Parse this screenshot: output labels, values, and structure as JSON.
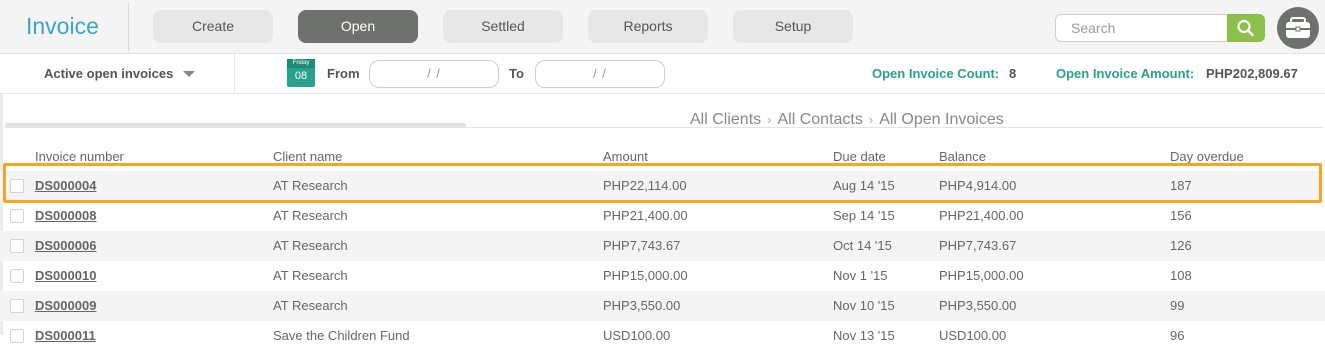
{
  "app": {
    "title": "Invoice"
  },
  "nav": {
    "items": [
      {
        "label": "Create"
      },
      {
        "label": "Open"
      },
      {
        "label": "Settled"
      },
      {
        "label": "Reports"
      },
      {
        "label": "Setup"
      }
    ],
    "active": "Open"
  },
  "search": {
    "placeholder": "Search"
  },
  "filter": {
    "view_label": "Active open invoices",
    "calendar": {
      "weekday": "Friday",
      "day": "08"
    },
    "from_label": "From",
    "from_value": "/     /",
    "to_label": "To",
    "to_value": "/     /"
  },
  "stats": {
    "count_label": "Open Invoice Count:",
    "count_value": "8",
    "amount_label": "Open Invoice Amount:",
    "amount_value": "PHP202,809.67"
  },
  "breadcrumb": [
    "All Clients",
    "All Contacts",
    "All Open Invoices"
  ],
  "table": {
    "columns": [
      "Invoice number",
      "Client name",
      "Amount",
      "Due date",
      "Balance",
      "Day overdue"
    ],
    "rows": [
      {
        "invoice": "DS000004",
        "client": "AT Research",
        "amount": "PHP22,114.00",
        "due": "Aug 14 '15",
        "balance": "PHP4,914.00",
        "overdue": "187"
      },
      {
        "invoice": "DS000008",
        "client": "AT Research",
        "amount": "PHP21,400.00",
        "due": "Sep 14 '15",
        "balance": "PHP21,400.00",
        "overdue": "156"
      },
      {
        "invoice": "DS000006",
        "client": "AT Research",
        "amount": "PHP7,743.67",
        "due": "Oct 14 '15",
        "balance": "PHP7,743.67",
        "overdue": "126"
      },
      {
        "invoice": "DS000010",
        "client": "AT Research",
        "amount": "PHP15,000.00",
        "due": "Nov 1 '15",
        "balance": "PHP15,000.00",
        "overdue": "108"
      },
      {
        "invoice": "DS000009",
        "client": "AT Research",
        "amount": "PHP3,550.00",
        "due": "Nov 10 '15",
        "balance": "PHP3,550.00",
        "overdue": "99"
      },
      {
        "invoice": "DS000011",
        "client": "Save the Children Fund",
        "amount": "USD100.00",
        "due": "Nov 13 '15",
        "balance": "USD100.00",
        "overdue": "96"
      }
    ],
    "selected_row": 0
  },
  "colors": {
    "brand": "#3aa5c4",
    "accent_green": "#2aa18b",
    "search_button": "#8cc04b",
    "active_nav": "#6e726c",
    "highlight": "#f5a623"
  },
  "icons": {
    "search": "search-icon",
    "profile": "briefcase-icon",
    "calendar": "calendar-icon",
    "dropdown": "chevron-down-icon",
    "breadcrumb_sep": "chevron-right-icon"
  }
}
